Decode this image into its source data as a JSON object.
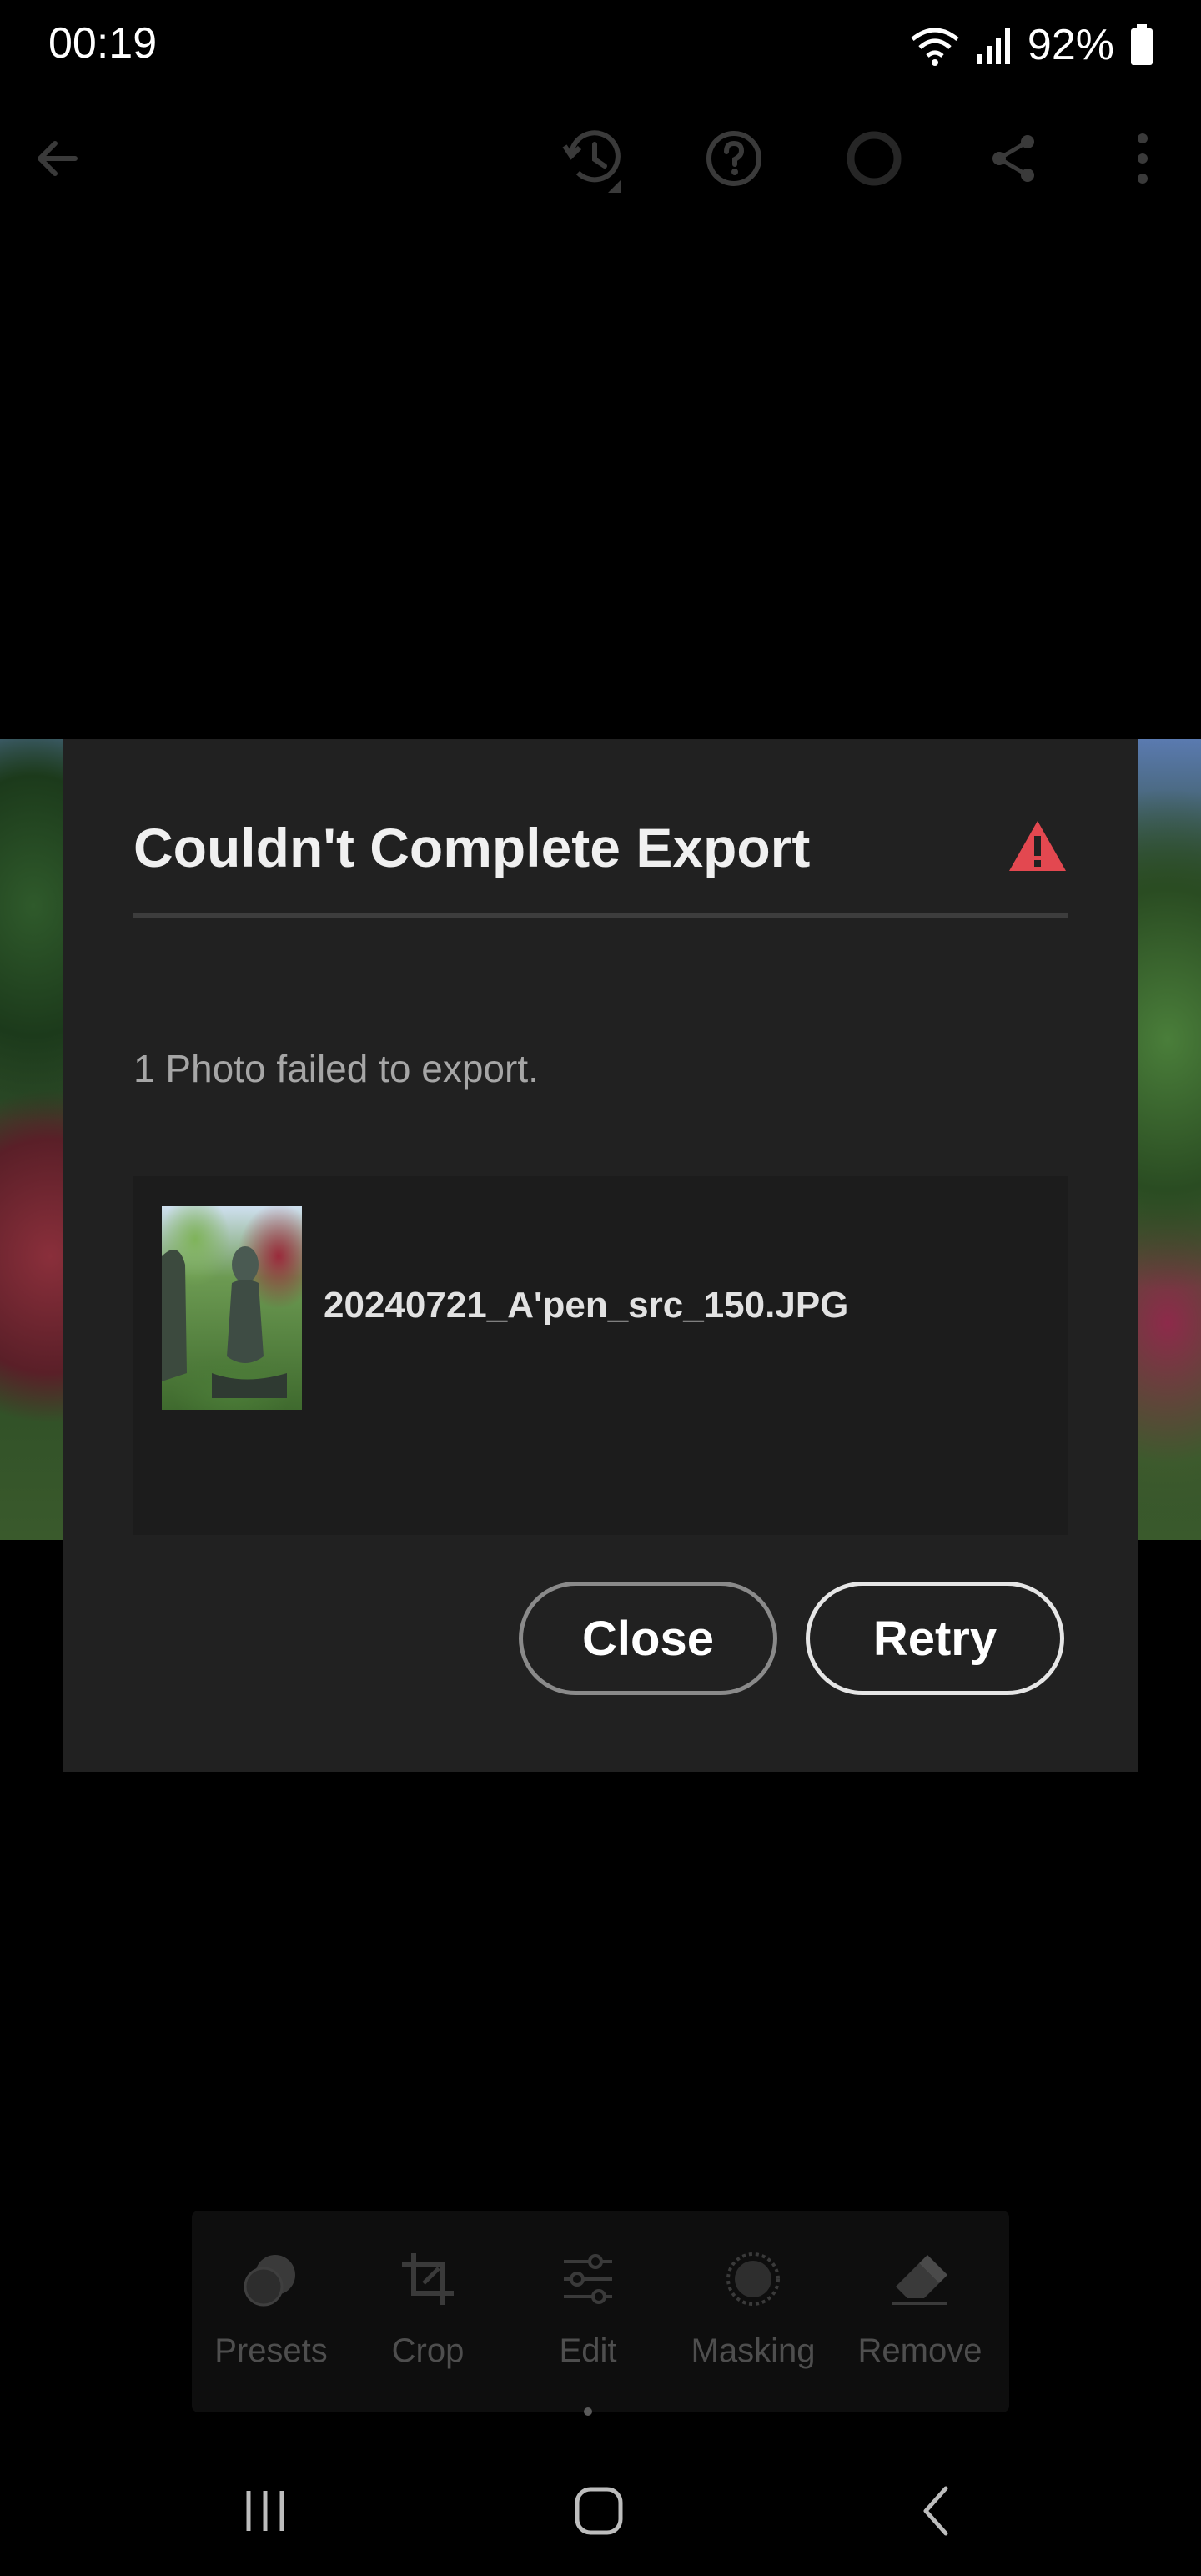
{
  "status": {
    "time": "00:19",
    "battery_pct": "92%"
  },
  "toolbar": {
    "icons": [
      "back-arrow-icon",
      "history-icon",
      "help-icon",
      "sync-progress-icon",
      "share-icon",
      "more-vertical-icon"
    ]
  },
  "dialog": {
    "title": "Couldn't Complete Export",
    "message": "1 Photo failed to export.",
    "file": {
      "name": "20240721_A'pen_src_150.JPG"
    },
    "close_label": "Close",
    "retry_label": "Retry",
    "warning_color": "#e34850"
  },
  "bottom_tools": [
    {
      "label": "Presets",
      "icon": "presets-icon"
    },
    {
      "label": "Crop",
      "icon": "crop-icon"
    },
    {
      "label": "Edit",
      "icon": "edit-sliders-icon"
    },
    {
      "label": "Masking",
      "icon": "masking-icon"
    },
    {
      "label": "Remove",
      "icon": "eraser-icon"
    }
  ],
  "nav": {
    "icons": [
      "recents-icon",
      "home-icon",
      "back-icon"
    ]
  }
}
